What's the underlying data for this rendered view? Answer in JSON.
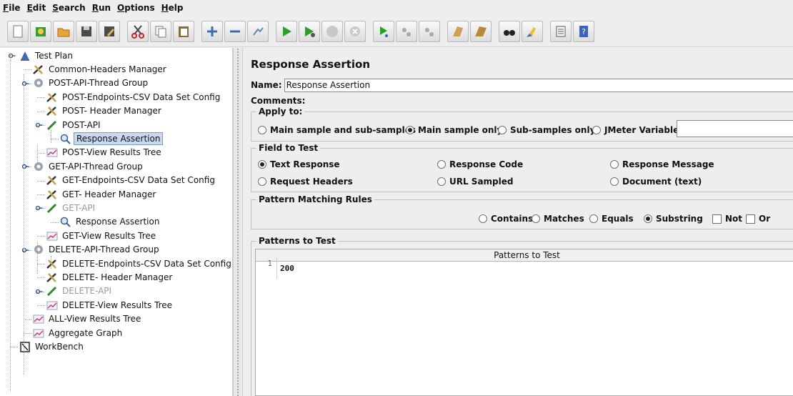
{
  "menubar": {
    "items": [
      {
        "label": "File",
        "u": "F"
      },
      {
        "label": "Edit",
        "u": "E"
      },
      {
        "label": "Search",
        "u": "S"
      },
      {
        "label": "Run",
        "u": "R"
      },
      {
        "label": "Options",
        "u": "O"
      },
      {
        "label": "Help",
        "u": "H"
      }
    ]
  },
  "toolbar": {
    "buttons": [
      "new-icon",
      "templates-icon",
      "open-icon",
      "save-icon",
      "save-as-icon",
      "cut-icon",
      "copy-icon",
      "paste-icon",
      "expand-icon",
      "collapse-icon",
      "toggle-icon",
      "start-icon",
      "start-no-pause-icon",
      "stop-icon",
      "shutdown-icon",
      "remote-start-icon",
      "remote-stop-icon",
      "remote-shutdown-icon",
      "clear-icon",
      "clear-all-icon",
      "search-icon",
      "reset-search-icon",
      "function-helper-icon",
      "help-icon"
    ]
  },
  "tree": {
    "nodes": [
      {
        "label": "Test Plan",
        "icon": "test-plan-icon"
      },
      {
        "label": "Common-Headers Manager",
        "icon": "config-icon"
      },
      {
        "label": "POST-API-Thread Group",
        "icon": "thread-group-icon"
      },
      {
        "label": "POST-Endpoints-CSV Data Set Config",
        "icon": "config-icon"
      },
      {
        "label": "POST- Header Manager",
        "icon": "config-icon"
      },
      {
        "label": "POST-API",
        "icon": "sampler-icon"
      },
      {
        "label": "Response Assertion",
        "icon": "assertion-icon"
      },
      {
        "label": "POST-View Results Tree",
        "icon": "listener-icon"
      },
      {
        "label": "GET-API-Thread Group",
        "icon": "thread-group-icon"
      },
      {
        "label": "GET-Endpoints-CSV Data Set Config",
        "icon": "config-icon"
      },
      {
        "label": "GET- Header Manager",
        "icon": "config-icon"
      },
      {
        "label": "GET-API",
        "icon": "sampler-icon"
      },
      {
        "label": "Response Assertion",
        "icon": "assertion-icon"
      },
      {
        "label": "GET-View Results Tree",
        "icon": "listener-icon"
      },
      {
        "label": "DELETE-API-Thread Group",
        "icon": "thread-group-icon"
      },
      {
        "label": "DELETE-Endpoints-CSV Data Set Config",
        "icon": "config-icon"
      },
      {
        "label": "DELETE- Header Manager",
        "icon": "config-icon"
      },
      {
        "label": "DELETE-API",
        "icon": "sampler-icon"
      },
      {
        "label": "DELETE-View Results Tree",
        "icon": "listener-icon"
      },
      {
        "label": "ALL-View Results Tree",
        "icon": "listener-icon"
      },
      {
        "label": "Aggregate Graph",
        "icon": "listener-icon"
      },
      {
        "label": "WorkBench",
        "icon": "workbench-icon"
      }
    ],
    "selected_index": 6,
    "disabled_indices": [
      11,
      17
    ]
  },
  "panel": {
    "title": "Response Assertion",
    "name_label": "Name:",
    "name_value": "Response Assertion",
    "comments_label": "Comments:",
    "apply_to": {
      "title": "Apply to:",
      "options": [
        "Main sample and sub-samples",
        "Main sample only",
        "Sub-samples only",
        "JMeter Variable"
      ],
      "selected": "Main sample only",
      "variable_value": ""
    },
    "field_to_test": {
      "title": "Field to Test",
      "options": [
        "Text Response",
        "Response Code",
        "Response Message",
        "Request Headers",
        "URL Sampled",
        "Document (text)"
      ],
      "selected": "Text Response"
    },
    "pattern_rules": {
      "title": "Pattern Matching Rules",
      "options": [
        "Contains",
        "Matches",
        "Equals",
        "Substring"
      ],
      "selected": "Substring",
      "not_label": "Not",
      "or_label": "Or",
      "not_checked": false,
      "or_checked": false
    },
    "patterns": {
      "title": "Patterns to Test",
      "column_header": "Patterns to Test",
      "rows": [
        {
          "line": "1",
          "value": "200"
        }
      ]
    }
  }
}
